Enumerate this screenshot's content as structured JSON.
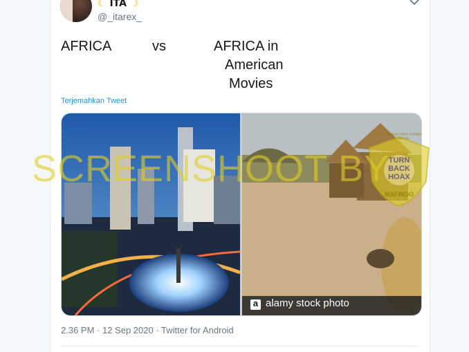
{
  "user": {
    "name": "ITA",
    "handle": "@_itarex_"
  },
  "tweet": {
    "lines": [
      {
        "text": "AFRICA"
      },
      {
        "text": "vs"
      },
      {
        "text": "AFRICA in"
      },
      {
        "text": "American"
      },
      {
        "text": "Movies"
      }
    ]
  },
  "translate_label": "Terjemahkan Tweet",
  "media": {
    "caption": "alamy stock photo",
    "caption_logo": "a"
  },
  "meta": "2.36 PM · 12 Sep 2020 · Twitter for Android",
  "watermark": {
    "text": "SCREENSHOOT BY",
    "seal_top": "TURN",
    "seal_mid": "BACK",
    "seal_bot": "HOAX",
    "seal_ring": "MASYARAKAT ANTI FITNAH INDONESIA",
    "seal_name": "MAFINDO"
  },
  "colors": {
    "link": "#1b95e0",
    "watermark": "#e1cd28",
    "muted": "#657786"
  },
  "icons": {
    "caret": "chevron-down-icon",
    "emoji": "crescent-moon-emoji"
  }
}
